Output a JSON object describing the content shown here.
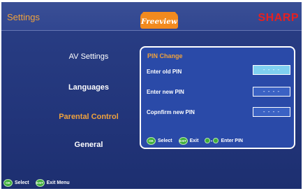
{
  "header": {
    "title": "Settings",
    "freeview_logo": "Freeview",
    "brand_logo": "SHARP"
  },
  "menu": {
    "items": [
      {
        "label": "AV Settings",
        "active": false
      },
      {
        "label": "Languages",
        "active": false
      },
      {
        "label": "Parental Control",
        "active": true
      },
      {
        "label": "General",
        "active": false
      }
    ]
  },
  "pin_panel": {
    "title": "PIN Change",
    "rows": [
      {
        "label": "Enter old PIN",
        "value": "- - - -",
        "state": "active"
      },
      {
        "label": "Enter new PIN",
        "value": "- - - -",
        "state": "inactive"
      },
      {
        "label": "Copnfirm new PIN",
        "value": "- - - -",
        "state": "inactive"
      }
    ],
    "hints": {
      "select_icon": "OK",
      "select_label": "Select",
      "exit_icon": "EXIT",
      "exit_label": "Exit",
      "enter_pin_label": "Enter PIN"
    }
  },
  "footer": {
    "select_icon": "OK",
    "select_label": "Select",
    "exit_icon": "EXIT",
    "exit_label": "Exit Menu"
  },
  "colors": {
    "background": "#22357a",
    "accent": "#f0a23c",
    "panel": "#2a4aa8",
    "active_field": "#7fd0f0",
    "brand": "#e62020",
    "ok_button": "#3fae3a"
  }
}
